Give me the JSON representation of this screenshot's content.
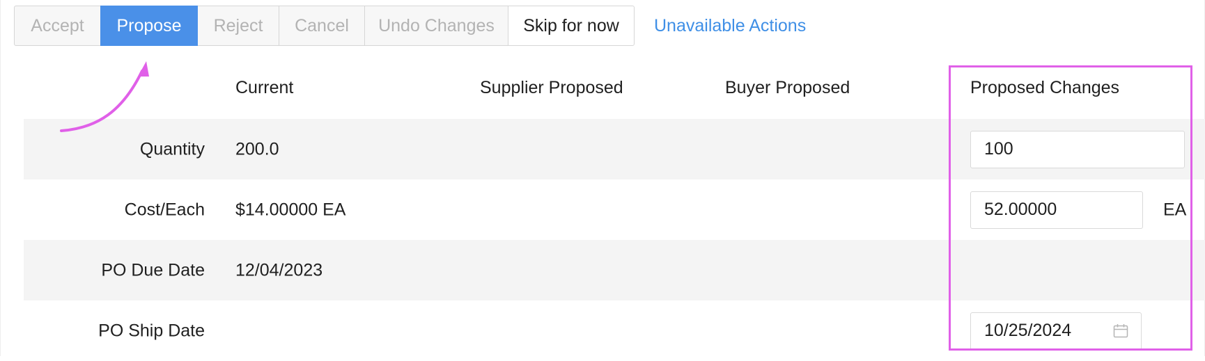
{
  "toolbar": {
    "accept_label": "Accept",
    "propose_label": "Propose",
    "reject_label": "Reject",
    "cancel_label": "Cancel",
    "undo_label": "Undo Changes",
    "skip_label": "Skip for now",
    "unavailable_label": "Unavailable Actions"
  },
  "columns": {
    "current": "Current",
    "supplier": "Supplier Proposed",
    "buyer": "Buyer Proposed",
    "proposed": "Proposed Changes"
  },
  "rows": [
    {
      "label": "Quantity",
      "current": "200.0",
      "proposed_value": "100"
    },
    {
      "label": "Cost/Each",
      "current": "$14.00000 EA",
      "proposed_value": "52.00000",
      "unit": "EA"
    },
    {
      "label": "PO Due Date",
      "current": "12/04/2023"
    },
    {
      "label": "PO Ship Date",
      "proposed_value": "10/25/2024"
    }
  ],
  "colors": {
    "primary": "#4a90e8",
    "link": "#3f8fe6",
    "annotation": "#e060e8",
    "row_shade": "#f4f4f4"
  },
  "icons": {
    "date_picker": "calendar-icon",
    "annotation_arrow": "curved-arrow-icon"
  }
}
